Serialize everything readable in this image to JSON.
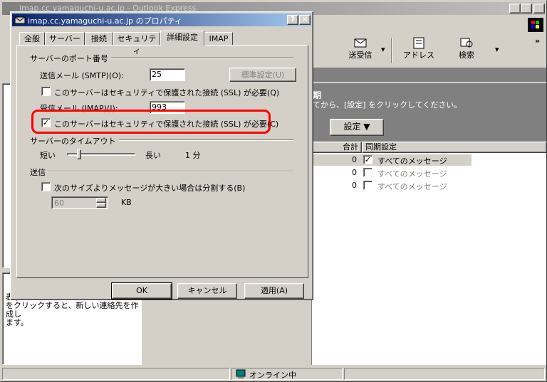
{
  "main_window": {
    "title": "imap.cc.yamaguchi-u.ac.jp - Outlook Express",
    "toolbar": {
      "send_receive": "送受信",
      "address": "アドレス",
      "search": "検索"
    },
    "panel": {
      "heading": "期",
      "instruction": "てから、[設定] をクリックしてください。",
      "settings_button": "設定 ▼"
    },
    "table": {
      "headers": [
        "合計",
        "同期設定"
      ],
      "rows": [
        {
          "count": "0",
          "checked": true,
          "label": "すべてのメッセージ"
        },
        {
          "count": "0",
          "checked": false,
          "label": "すべてのメッセージ"
        },
        {
          "count": "0",
          "checked": false,
          "label": "すべてのメッセージ"
        }
      ]
    },
    "contacts_text": "表示\nをクリックすると、新しい連絡先を作成し\nます。",
    "status": "オンライン中"
  },
  "dialog": {
    "title": "imap.cc.yamaguchi-u.ac.jp のプロパティ",
    "tabs": [
      "全般",
      "サーバー",
      "接続",
      "セキュリティ",
      "詳細設定",
      "IMAP"
    ],
    "active_tab": "詳細設定",
    "ports_group": "サーバーのポート番号",
    "smtp_label": "送信メール (SMTP)(O):",
    "smtp_value": "25",
    "default_button": "標準設定(U)",
    "smtp_ssl_label": "このサーバーはセキュリティで保護された接続 (SSL) が必要(Q)",
    "imap_label": "受信メール (IMAP)(I):",
    "imap_value": "993",
    "imap_ssl_label": "このサーバーはセキュリティで保護された接続 (SSL) が必要(C)",
    "timeout_group": "サーバーのタイムアウト",
    "short_label": "短い",
    "long_label": "長い",
    "timeout_value": "1 分",
    "send_group": "送信",
    "split_label": "次のサイズよりメッセージが大きい場合は分割する(B)",
    "split_value": "60",
    "split_unit": "KB",
    "ok_button": "OK",
    "cancel_button": "キャンセル",
    "apply_button": "適用(A)"
  }
}
